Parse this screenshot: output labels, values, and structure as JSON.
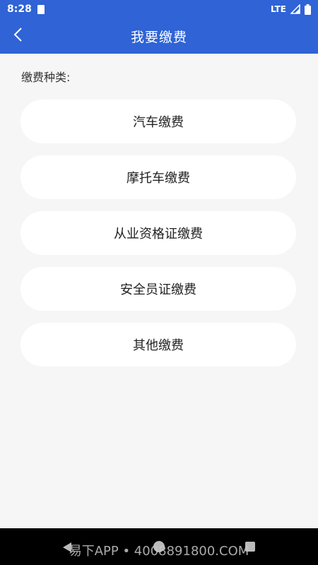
{
  "status_bar": {
    "time": "8:28",
    "network": "LTE"
  },
  "header": {
    "title": "我要缴费",
    "background_color": "#2f63d6"
  },
  "main": {
    "section_label": "缴费种类:",
    "options": [
      {
        "label": "汽车缴费"
      },
      {
        "label": "摩托车缴费"
      },
      {
        "label": "从业资格证缴费"
      },
      {
        "label": "安全员证缴费"
      },
      {
        "label": "其他缴费"
      }
    ]
  },
  "system_nav": {
    "watermark": "易下APP • 4008891800.COM"
  },
  "icons": {
    "back": "chevron-left-icon",
    "sim": "sim-card-icon",
    "signal": "signal-icon",
    "battery": "battery-icon"
  }
}
